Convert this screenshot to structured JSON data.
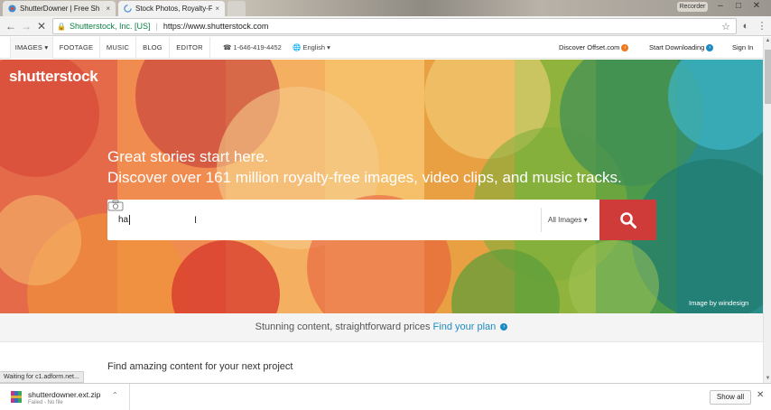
{
  "browser": {
    "tabs": [
      {
        "title": "ShutterDowner | Free Sh",
        "close": "×"
      },
      {
        "title": "Stock Photos, Royalty-Fr",
        "close": "×"
      }
    ],
    "recorder_label": "Recorder",
    "window_controls": {
      "minimize": "–",
      "maximize": "□",
      "close": "✕"
    },
    "nav": {
      "back": "←",
      "forward": "→",
      "stop": "✕"
    },
    "address": {
      "org": "Shutterstock, Inc. [US]",
      "url": "https://www.shutterstock.com"
    }
  },
  "site_nav": {
    "items": [
      "IMAGES ▾",
      "FOOTAGE",
      "MUSIC",
      "BLOG",
      "EDITOR"
    ],
    "phone": "1-646-419-4452",
    "language": "English ▾",
    "discover": "Discover Offset.com",
    "start": "Start Downloading",
    "signin": "Sign In"
  },
  "hero": {
    "logo": "shutterstock",
    "headline": "Great stories start here.",
    "subheadline": "Discover over 161 million royalty-free images, video clips, and music tracks.",
    "search_value": "ha",
    "dropdown": "All Images ▾",
    "credit": "Image by windesign"
  },
  "pricing": {
    "text": "Stunning content, straightforward prices",
    "link": "Find your plan"
  },
  "find_heading": "Find amazing content for your next project",
  "status": "Waiting for c1.adform.net...",
  "downloads": {
    "file": "shutterdowner.ext.zip",
    "state": "Failed - No file",
    "show_all": "Show all"
  },
  "colors": {
    "accent_red": "#cf3b38",
    "link_blue": "#1d8bc3",
    "offset_orange": "#f0781e"
  }
}
